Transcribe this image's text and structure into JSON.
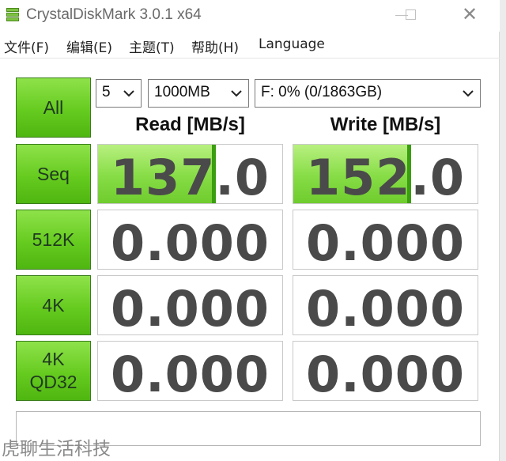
{
  "window": {
    "title": "CrystalDiskMark 3.0.1 x64"
  },
  "menu": [
    "文件(F)",
    "编辑(E)",
    "主题(T)",
    "帮助(H)",
    "Language"
  ],
  "controls": {
    "runs": "5",
    "size": "1000MB",
    "drive": "F: 0% (0/1863GB)"
  },
  "buttons": {
    "all": "All",
    "seq": "Seq",
    "k512": "512K",
    "k4": "4K",
    "qd32_line1": "4K",
    "qd32_line2": "QD32"
  },
  "headers": {
    "read": "Read [MB/s]",
    "write": "Write [MB/s]"
  },
  "results": {
    "seq": {
      "read": "137.0",
      "write": "152.0",
      "read_fill": 0.64,
      "write_fill": 0.64
    },
    "k512": {
      "read": "0.000",
      "write": "0.000",
      "read_fill": 0,
      "write_fill": 0
    },
    "k4": {
      "read": "0.000",
      "write": "0.000",
      "read_fill": 0,
      "write_fill": 0
    },
    "qd32": {
      "read": "0.000",
      "write": "0.000",
      "read_fill": 0,
      "write_fill": 0
    }
  },
  "status_text": "",
  "watermark": "虎聊生活科技",
  "colors": {
    "accent_green": "#66cb1f",
    "bar_green": "#86dc45",
    "bar_edge": "#3a9e10"
  },
  "icons": [
    "app-icon",
    "minimize-icon",
    "maximize-icon",
    "close-icon",
    "chevron-down-icon"
  ]
}
